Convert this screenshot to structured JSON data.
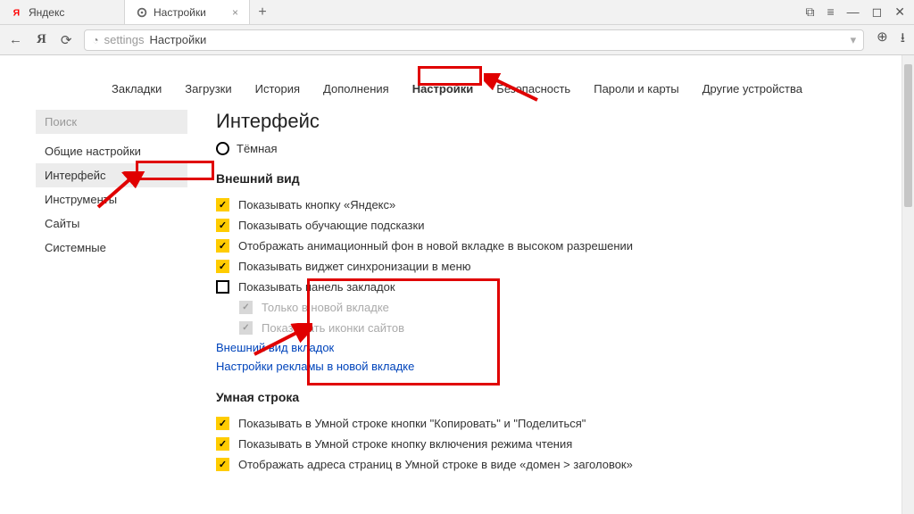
{
  "browser": {
    "tabs": [
      "Яндекс",
      "Настройки"
    ],
    "newtab": "+",
    "omnibox_prefix": "settings",
    "omnibox_text": " Настройки"
  },
  "nav_tabs": [
    "Закладки",
    "Загрузки",
    "История",
    "Дополнения",
    "Настройки",
    "Безопасность",
    "Пароли и карты",
    "Другие устройства"
  ],
  "sidebar": {
    "search_placeholder": "Поиск",
    "items": [
      "Общие настройки",
      "Интерфейс",
      "Инструменты",
      "Сайты",
      "Системные"
    ]
  },
  "main": {
    "title": "Интерфейс",
    "truncated_radio": "Тёмная",
    "appearance_head": "Внешний вид",
    "appearance_items": [
      "Показывать кнопку «Яндекс»",
      "Показывать обучающие подсказки",
      "Отображать анимационный фон в новой вкладке в высоком разрешении",
      "Показывать виджет синхронизации в меню"
    ],
    "bookmarks_panel": "Показывать панель закладок",
    "bookmarks_sub": [
      "Только в новой вкладке",
      "Показывать иконки сайтов"
    ],
    "links": [
      "Внешний вид вкладок",
      "Настройки рекламы в новой вкладке"
    ],
    "smart_head": "Умная строка",
    "smart_items": [
      "Показывать в Умной строке кнопки \"Копировать\" и \"Поделиться\"",
      "Показывать в Умной строке кнопку включения режима чтения",
      "Отображать адреса страниц в Умной строке в виде «домен > заголовок»"
    ]
  }
}
